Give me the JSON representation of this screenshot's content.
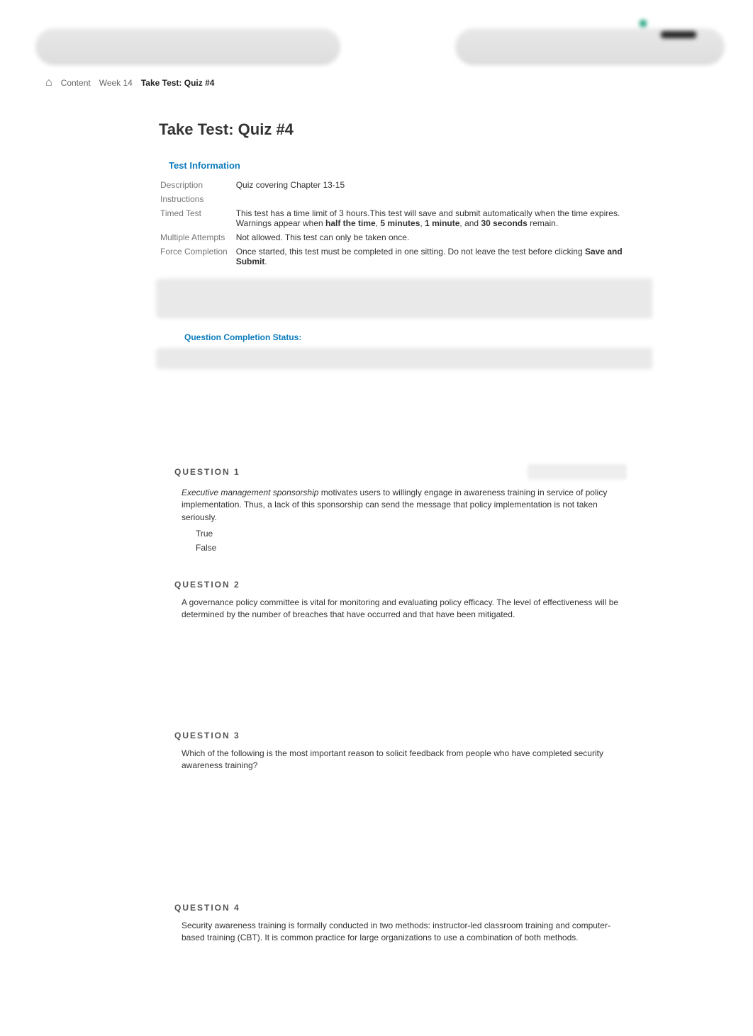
{
  "breadcrumb": {
    "items": [
      "Content",
      "Week 14"
    ],
    "current": "Take Test: Quiz #4"
  },
  "page_title": "Take Test: Quiz #4",
  "test_info": {
    "heading": "Test Information",
    "rows": {
      "description_label": "Description",
      "description_value": "Quiz covering Chapter 13-15",
      "instructions_label": "Instructions",
      "timed_label": "Timed Test",
      "timed_pre": "This test has a time limit of 3 hours.This test will save and submit automatically when the time expires.",
      "timed_warn_prefix": "Warnings appear when ",
      "timed_warn_b1": "half the time",
      "timed_warn_sep1": ", ",
      "timed_warn_b2": "5 minutes",
      "timed_warn_sep2": ", ",
      "timed_warn_b3": "1 minute",
      "timed_warn_sep3": ", and ",
      "timed_warn_b4": "30 seconds",
      "timed_warn_suffix": " remain.",
      "multi_label": "Multiple Attempts",
      "multi_value": "Not allowed. This test can only be taken once.",
      "force_label": "Force Completion",
      "force_pre": "Once started, this test must be completed in one sitting. Do not leave the test before clicking ",
      "force_bold": "Save and Submit",
      "force_post": "."
    }
  },
  "qcs_label": "Question Completion Status:",
  "questions": [
    {
      "num": "QUESTION 1",
      "italic_lead": "Executive management sponsorship",
      "text_rest": " motivates users to willingly engage in awareness training in service of policy implementation. Thus, a lack of this sponsorship can send the message that policy implementation is not taken seriously.",
      "options": [
        "True",
        "False"
      ],
      "show_points_blur": true
    },
    {
      "num": "QUESTION 2",
      "text_plain": "A governance policy committee is vital for monitoring and evaluating policy efficacy. The level of effectiveness will be determined by the number of breaches that have occurred and that have been mitigated."
    },
    {
      "num": "QUESTION 3",
      "text_plain": "Which of the following is the most important reason to solicit feedback from people who have completed security awareness training?"
    },
    {
      "num": "QUESTION 4",
      "text_plain": "Security awareness training is formally conducted in two methods: instructor-led classroom training and computer-based training (CBT). It is common practice for large organizations to use a combination of both methods."
    }
  ]
}
